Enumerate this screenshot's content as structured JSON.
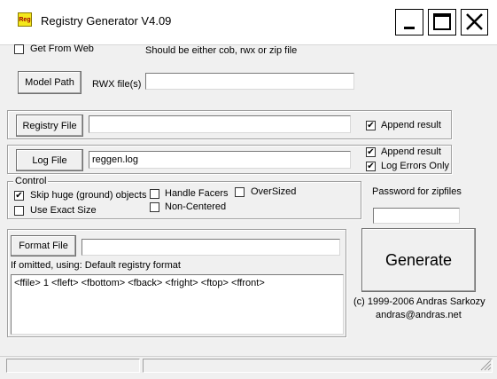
{
  "window": {
    "title": "Registry Generator V4.09",
    "icon_text": "Reg"
  },
  "title_buttons": {
    "minimize": "minimize-icon",
    "maximize": "maximize-icon",
    "close": "close-icon"
  },
  "get_from_web": {
    "label": "Get From Web",
    "checked": false
  },
  "hint": "Should be  either cob, rwx or zip file",
  "model_path": {
    "button_label": "Model Path",
    "field_label": "RWX file(s)",
    "value": ""
  },
  "registry_file": {
    "button_label": "Registry File",
    "value": "",
    "append_label": "Append result",
    "append_checked": true
  },
  "log_file": {
    "button_label": "Log File",
    "value": "reggen.log",
    "append_label": "Append result",
    "append_checked": true,
    "errors_label": "Log Errors Only",
    "errors_checked": true
  },
  "control": {
    "legend": "Control",
    "skip_huge": {
      "label": "Skip huge (ground) objects",
      "checked": true
    },
    "exact_size": {
      "label": "Use Exact Size",
      "checked": false
    },
    "handle_facers": {
      "label": "Handle Facers",
      "checked": false
    },
    "non_centered": {
      "label": "Non-Centered",
      "checked": false
    },
    "oversized": {
      "label": "OverSized",
      "checked": false
    }
  },
  "password": {
    "label": "Password for zipfiles",
    "value": ""
  },
  "format_file": {
    "button_label": "Format File",
    "value": "",
    "omitted_note": "If omitted, using: Default registry format",
    "format_text": "<ffile> 1 <fleft> <fbottom> <fback> <fright> <ftop> <ffront>"
  },
  "generate_label": "Generate",
  "copyright": "(c) 1999-2006  Andras Sarkozy",
  "email": "andras@andras.net",
  "check_glyph": "✔"
}
